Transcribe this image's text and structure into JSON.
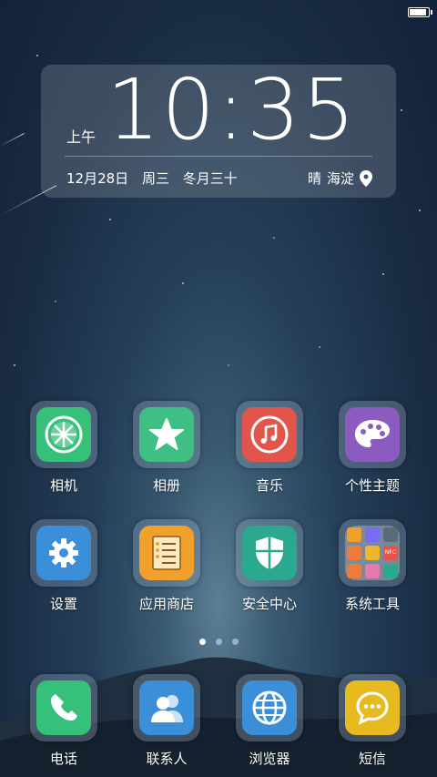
{
  "clock": {
    "ampm": "上午",
    "time": "10:35",
    "date": "12月28日",
    "weekday": "周三",
    "lunar": "冬月三十",
    "weather": "晴",
    "location": "海淀"
  },
  "apps": [
    {
      "label": "相机",
      "icon": "camera-icon",
      "color": "#37c07a"
    },
    {
      "label": "相册",
      "icon": "star-icon",
      "color": "#3fbf84"
    },
    {
      "label": "音乐",
      "icon": "music-icon",
      "color": "#e2554a"
    },
    {
      "label": "个性主题",
      "icon": "palette-icon",
      "color": "#8c5bbf"
    },
    {
      "label": "设置",
      "icon": "gear-icon",
      "color": "#3b8fd8"
    },
    {
      "label": "应用商店",
      "icon": "app-store-icon",
      "color": "#f1a12b"
    },
    {
      "label": "安全中心",
      "icon": "shield-icon",
      "color": "#2aa98e"
    },
    {
      "label": "系统工具",
      "icon": "folder-icon",
      "color": "#9aa8b4"
    }
  ],
  "dock": [
    {
      "label": "电话",
      "icon": "phone-icon",
      "color": "#37c07a"
    },
    {
      "label": "联系人",
      "icon": "contacts-icon",
      "color": "#3b8fd8"
    },
    {
      "label": "浏览器",
      "icon": "globe-icon",
      "color": "#3b8fd8"
    },
    {
      "label": "短信",
      "icon": "message-icon",
      "color": "#e7bb1f"
    }
  ],
  "folder_mini": {
    "nfc": "NFC"
  },
  "pages": {
    "count": 3,
    "active": 1
  }
}
